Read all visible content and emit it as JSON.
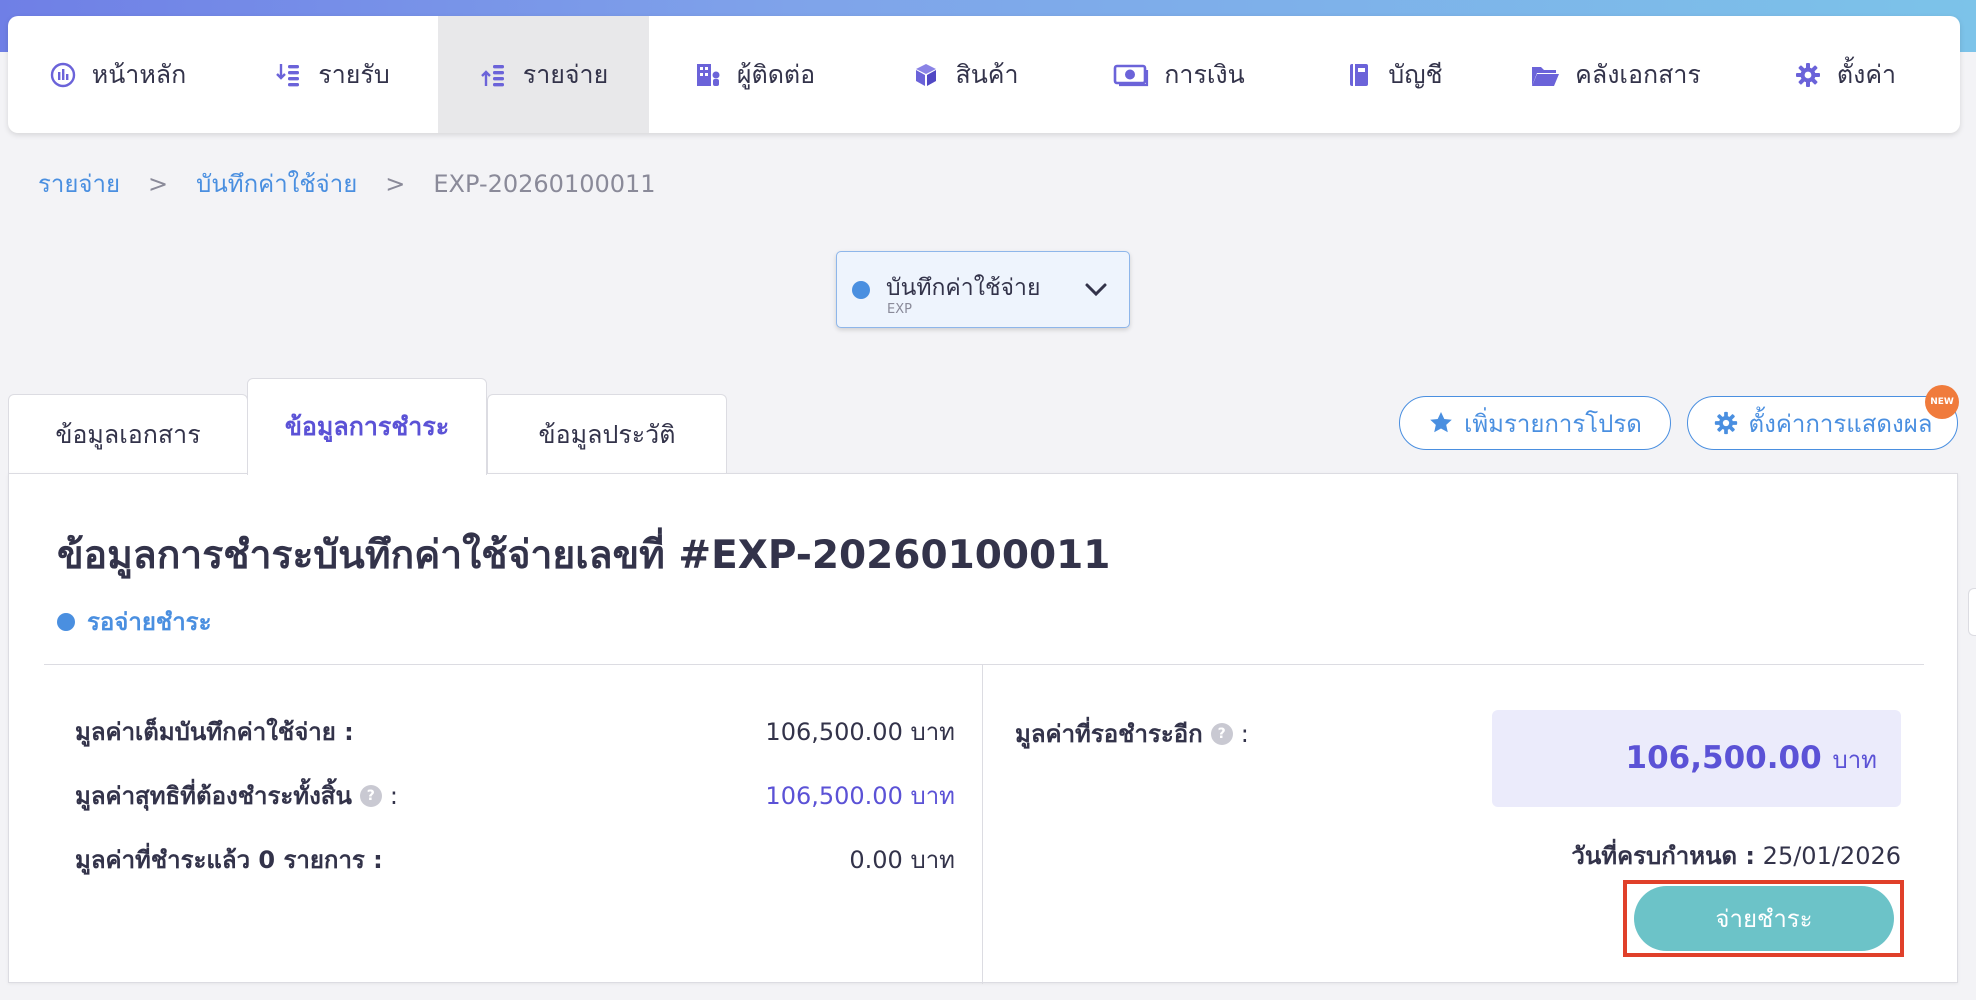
{
  "nav": {
    "items": [
      {
        "label": "หน้าหลัก",
        "icon": "dashboard-icon"
      },
      {
        "label": "รายรับ",
        "icon": "income-icon"
      },
      {
        "label": "รายจ่าย",
        "icon": "expense-icon",
        "active": true
      },
      {
        "label": "ผู้ติดต่อ",
        "icon": "contacts-icon"
      },
      {
        "label": "สินค้า",
        "icon": "product-box-icon"
      },
      {
        "label": "การเงิน",
        "icon": "money-icon"
      },
      {
        "label": "บัญชี",
        "icon": "accounting-book-icon"
      },
      {
        "label": "คลังเอกสาร",
        "icon": "folder-icon"
      },
      {
        "label": "ตั้งค่า",
        "icon": "gear-icon"
      }
    ]
  },
  "breadcrumb": {
    "level1": "รายจ่าย",
    "sep": ">",
    "level2": "บันทึกค่าใช้จ่าย",
    "current": "EXP-20260100011"
  },
  "doc_type_select": {
    "label": "บันทึกค่าใช้จ่าย",
    "code": "EXP"
  },
  "tabs": [
    {
      "label": "ข้อมูลเอกสาร"
    },
    {
      "label": "ข้อมูลการชำระ",
      "active": true
    },
    {
      "label": "ข้อมูลประวัติ"
    }
  ],
  "actions": {
    "favorite_label": "เพิ่มรายการโปรด",
    "display_settings_label": "ตั้งค่าการแสดงผล",
    "new_badge": "NEW"
  },
  "payment": {
    "title": "ข้อมูลการชำระบันทึกค่าใช้จ่ายเลขที่ #EXP-20260100011",
    "status": "รอจ่ายชำระ",
    "rows": [
      {
        "label": "มูลค่าเต็มบันทึกค่าใช้จ่าย :",
        "value": "106,500.00 บาท"
      },
      {
        "label": "มูลค่าสุทธิที่ต้องชำระทั้งสิ้น",
        "suffix": ":",
        "value": "106,500.00 บาท"
      },
      {
        "label": "มูลค่าที่ชำระแล้ว 0 รายการ :",
        "value": "0.00 บาท"
      }
    ],
    "remaining_label": "มูลค่าที่รอชำระอีก",
    "remaining_suffix": ":",
    "remaining_amount": "106,500.00",
    "remaining_unit": "บาท",
    "due_label": "วันที่ครบกำหนด :",
    "due_date": "25/01/2026",
    "pay_button": "จ่ายชำระ",
    "help_glyph": "?"
  },
  "colors": {
    "accent_purple": "#5b52d6",
    "link_blue": "#4a8fe0",
    "pay_button": "#6cc3c8",
    "highlight_outline": "#e0402a"
  }
}
